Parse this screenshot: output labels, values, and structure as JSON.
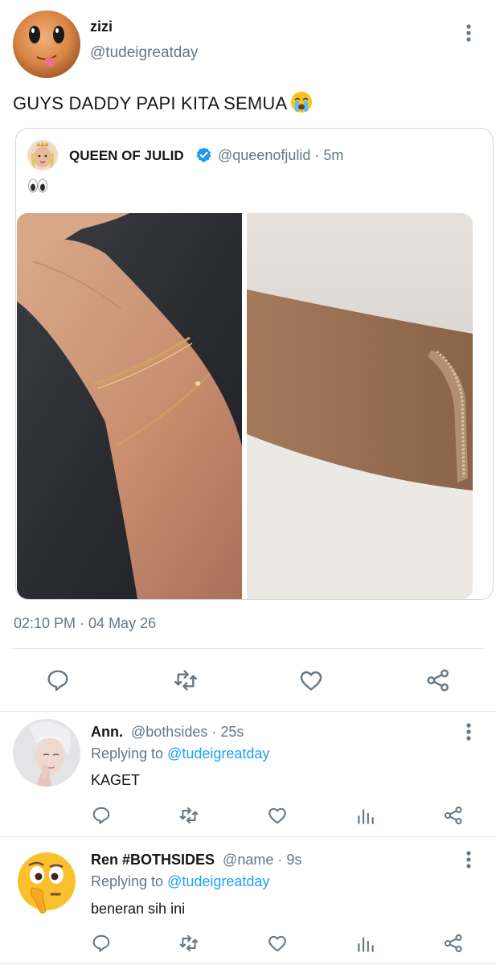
{
  "main_tweet": {
    "name": "zizi",
    "handle": "@tudeigreatday",
    "text": "GUYS DADDY PAPI KITA SEMUA",
    "emoji": "sob-emoji",
    "timestamp": "02:10 PM · 04 May 26",
    "quote": {
      "name": "QUEEN OF JULID",
      "verified": true,
      "meta": "@queenofjulid · 5m",
      "text_emoji": "eyes-emoji"
    }
  },
  "replies": [
    {
      "name": "Ann.",
      "meta": "@bothsides · 25s",
      "replying_label": "Replying to",
      "replying_handle": "@tudeigreatday",
      "text": "KAGET"
    },
    {
      "name": "Ren #BOTHSIDES",
      "meta": "@name · 9s",
      "replying_label": "Replying to",
      "replying_handle": "@tudeigreatday",
      "text": "beneran sih ini"
    }
  ],
  "colors": {
    "accent": "#1da1f2",
    "secondary_text": "#657786",
    "verified": "#1d9bf0",
    "icon": "#657786"
  }
}
